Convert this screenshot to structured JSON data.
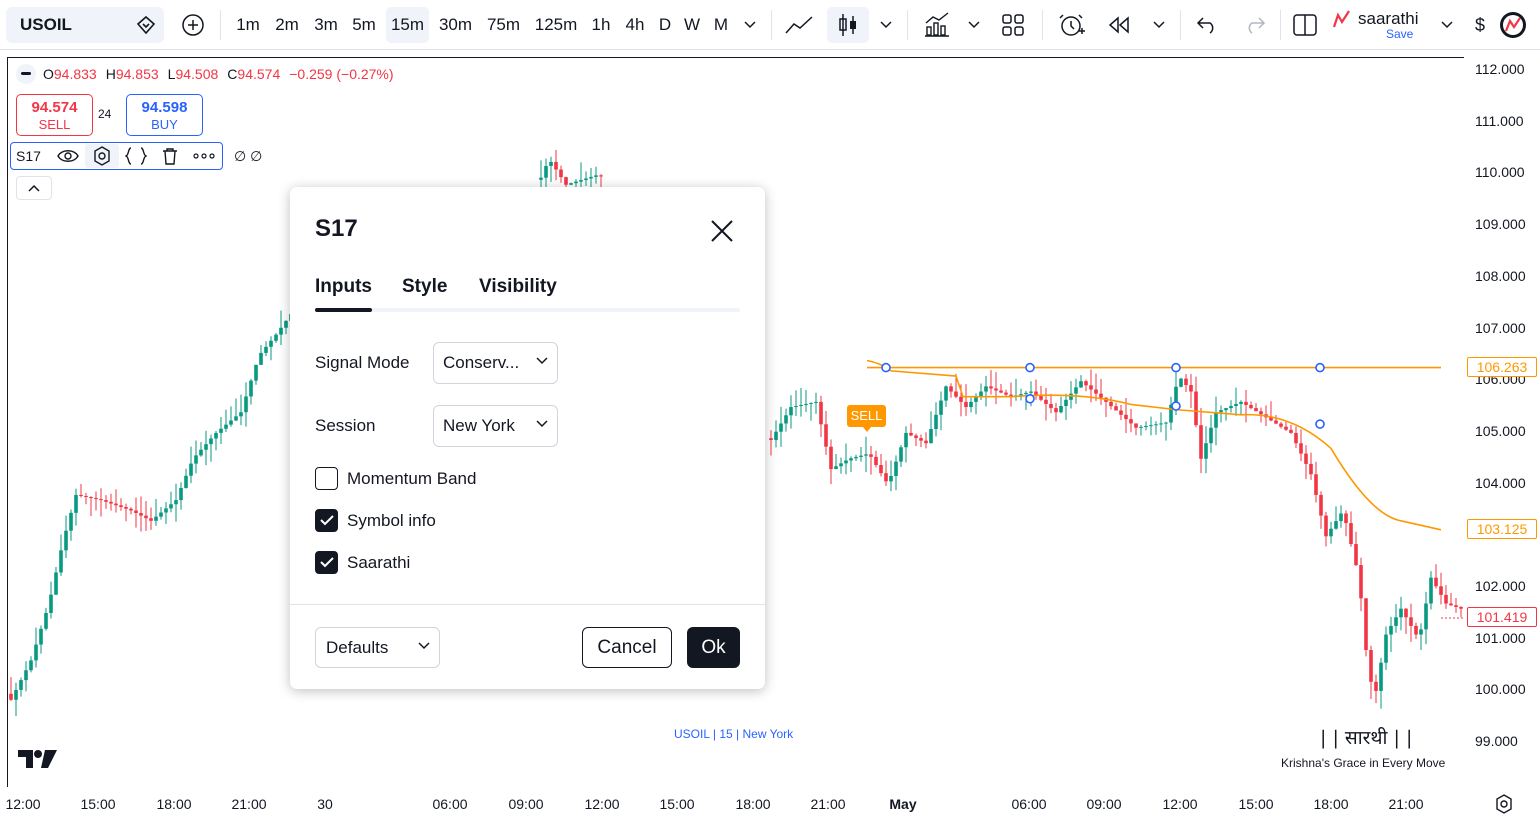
{
  "toolbar": {
    "symbol": "USOIL",
    "intervals": [
      "1m",
      "2m",
      "3m",
      "5m",
      "15m",
      "30m",
      "75m",
      "125m",
      "1h",
      "4h",
      "D",
      "W",
      "M"
    ],
    "active_interval": "15m",
    "layout_name": "saarathi",
    "layout_save": "Save",
    "currency_symbol": "$"
  },
  "legend": {
    "open_label": "O",
    "open": "94.833",
    "high_label": "H",
    "high": "94.853",
    "low_label": "L",
    "low": "94.508",
    "close_label": "C",
    "close": "94.574",
    "change": "−0.259 (−0.27%)",
    "sell_price": "94.574",
    "sell_label": "SELL",
    "spread": "24",
    "buy_price": "94.598",
    "buy_label": "BUY",
    "study_name": "S17",
    "study_values": "∅ ∅"
  },
  "price_axis": {
    "labels": [
      "112.000",
      "111.000",
      "110.000",
      "109.000",
      "108.000",
      "107.000",
      "106.000",
      "105.000",
      "104.000",
      "103.000",
      "102.000",
      "101.000",
      "100.000",
      "99.000"
    ],
    "tags": [
      {
        "value": "106.263",
        "color": "#ff9800"
      },
      {
        "value": "103.125",
        "color": "#ff9800"
      },
      {
        "value": "101.419",
        "color": "#f23645"
      }
    ]
  },
  "time_axis": {
    "labels": [
      "12:00",
      "15:00",
      "18:00",
      "21:00",
      "30",
      "06:00",
      "09:00",
      "12:00",
      "15:00",
      "18:00",
      "21:00",
      "May",
      "06:00",
      "09:00",
      "12:00",
      "15:00",
      "18:00",
      "21:00"
    ]
  },
  "chart": {
    "signal_label": "SELL",
    "watermark": "USOIL  |  15  |  New York",
    "brand_devanagari": "| | सारथी | |",
    "brand_tagline": "Krishna's Grace in Every Move",
    "up_color": "#089981",
    "down_color": "#f23645",
    "indicator_color": "#ff9800",
    "marker_color": "#2962ff"
  },
  "dialog": {
    "title": "S17",
    "tabs": [
      "Inputs",
      "Style",
      "Visibility"
    ],
    "active_tab": "Inputs",
    "fields": [
      {
        "label": "Signal Mode",
        "value": "Conserv..."
      },
      {
        "label": "Session",
        "value": "New York"
      }
    ],
    "checkboxes": [
      {
        "label": "Momentum Band",
        "checked": false
      },
      {
        "label": "Symbol info",
        "checked": true
      },
      {
        "label": "Saarathi",
        "checked": true
      }
    ],
    "defaults_label": "Defaults",
    "cancel_label": "Cancel",
    "ok_label": "Ok"
  }
}
